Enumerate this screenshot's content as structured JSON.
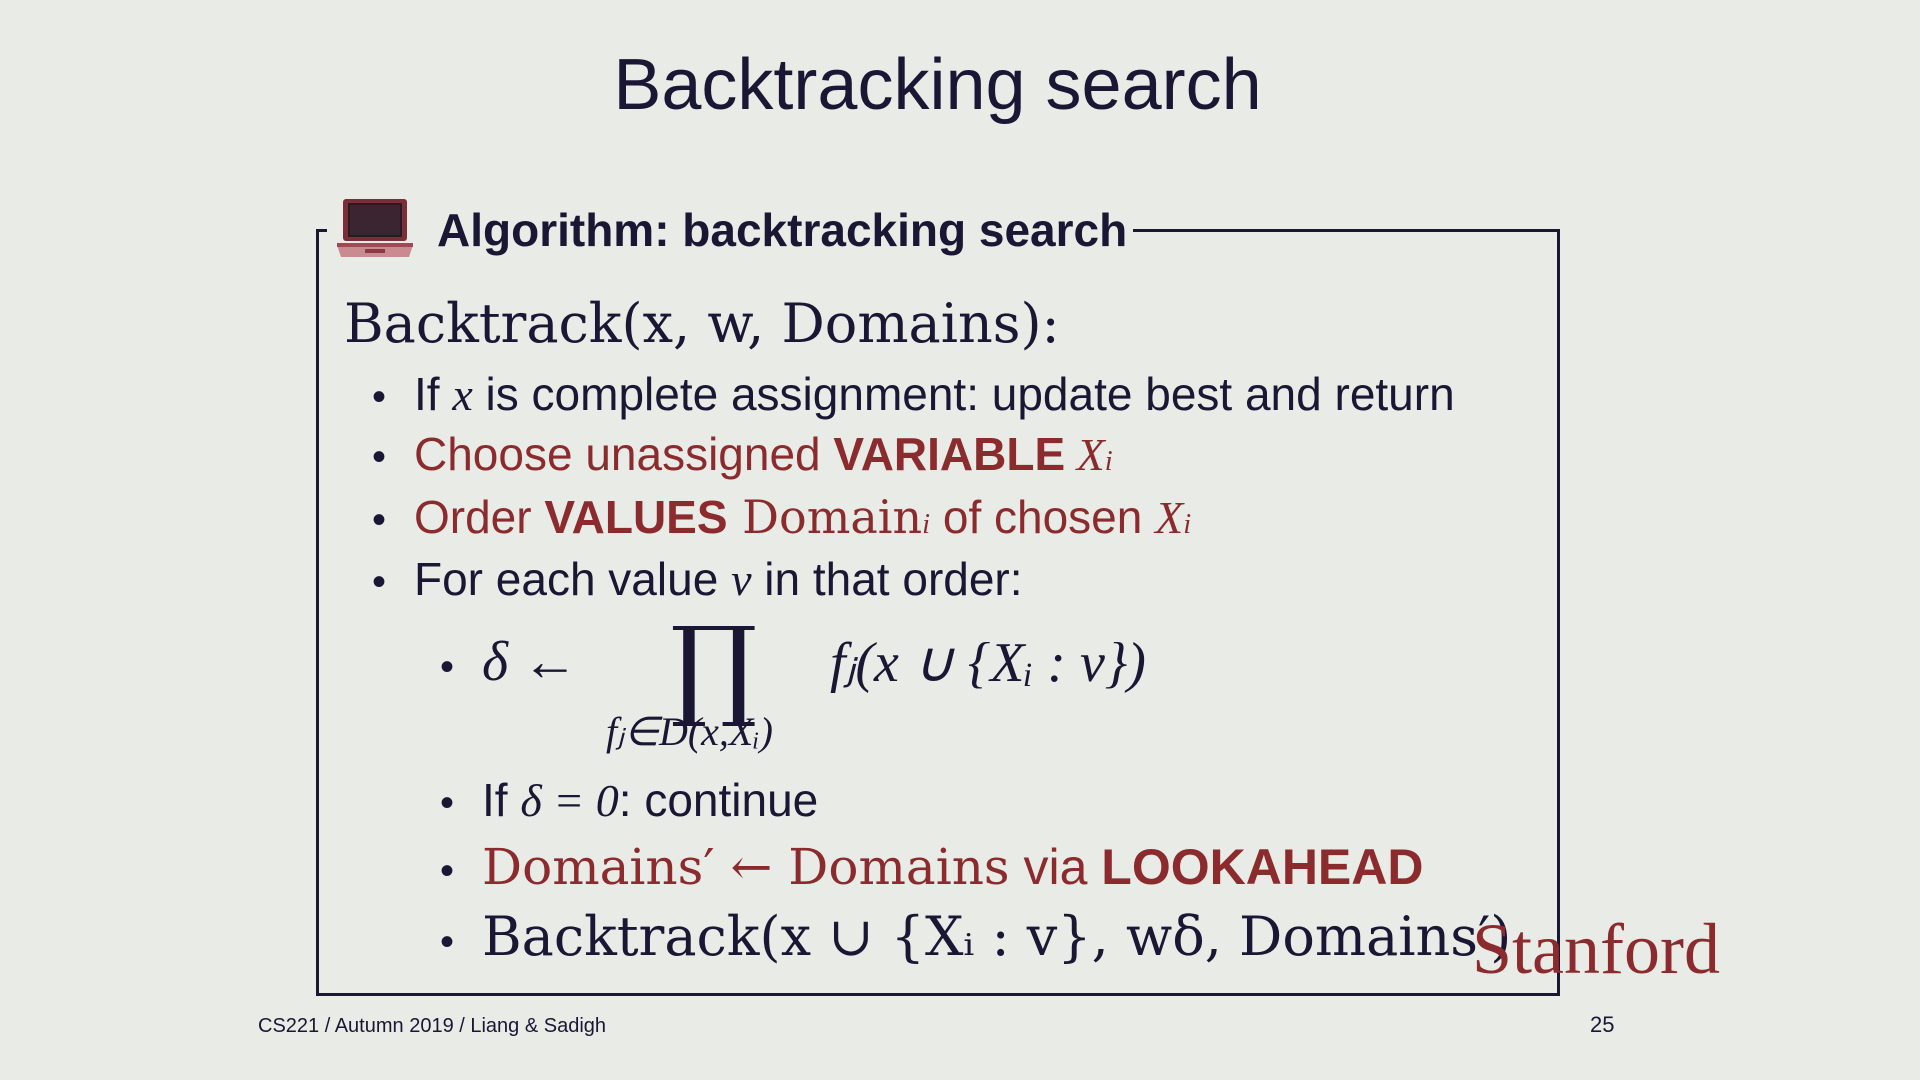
{
  "slide": {
    "title": "Backtracking search",
    "footer": "CS221 / Autumn 2019 / Liang & Sadigh",
    "page_number": "25",
    "logo": "Stanford"
  },
  "algorithm": {
    "icon": "laptop-icon",
    "title": "Algorithm: backtracking search",
    "function": "Backtrack(x, w, Domains):",
    "steps": [
      {
        "parts": [
          {
            "text": "If ",
            "style": "plain"
          },
          {
            "text": "x",
            "style": "math"
          },
          {
            "text": " is complete assignment: update best and return",
            "style": "plain"
          }
        ]
      },
      {
        "parts": [
          {
            "text": "Choose unassigned ",
            "style": "red"
          },
          {
            "text": "VARIABLE",
            "style": "red-bold"
          },
          {
            "text": " X",
            "style": "red-math"
          },
          {
            "text": "i",
            "style": "red-math-sub"
          }
        ]
      },
      {
        "parts": [
          {
            "text": "Order ",
            "style": "red"
          },
          {
            "text": "VALUES",
            "style": "red-bold"
          },
          {
            "text": " Domain",
            "style": "red-serif"
          },
          {
            "text": "i",
            "style": "red-math-sub"
          },
          {
            "text": " of chosen ",
            "style": "red"
          },
          {
            "text": "X",
            "style": "red-math"
          },
          {
            "text": "i",
            "style": "red-math-sub"
          }
        ]
      },
      {
        "parts": [
          {
            "text": "For each value ",
            "style": "plain"
          },
          {
            "text": "v",
            "style": "math"
          },
          {
            "text": " in that order:",
            "style": "plain"
          }
        ]
      }
    ],
    "product": {
      "lhs": "δ ←",
      "symbol": "∏",
      "under": "fⱼ∈D(x,Xᵢ)",
      "rhs": "fⱼ(x ∪ {Xᵢ : v})"
    },
    "substeps": [
      {
        "parts": [
          {
            "text": "If ",
            "style": "plain"
          },
          {
            "text": "δ = 0",
            "style": "math"
          },
          {
            "text": ": continue",
            "style": "plain"
          }
        ]
      },
      {
        "parts": [
          {
            "text": "Domains′ ← Domains",
            "style": "red-serif"
          },
          {
            "text": " via ",
            "style": "red"
          },
          {
            "text": "LOOKAHEAD",
            "style": "red-bold"
          }
        ]
      },
      {
        "parts": [
          {
            "text": "Backtrack(x ∪ {Xᵢ : v}, wδ, Domains′)",
            "style": "serif"
          }
        ]
      }
    ]
  },
  "colors": {
    "background": "#e8ebe6",
    "text": "#1a1633",
    "accent": "#8c2b2e"
  }
}
